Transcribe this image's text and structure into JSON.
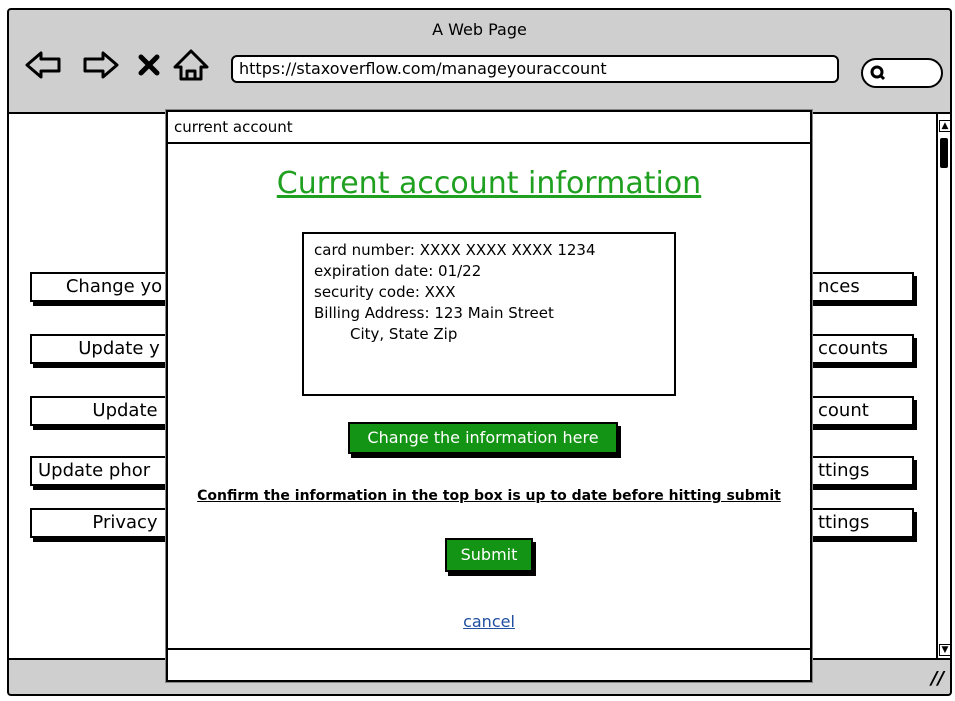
{
  "window": {
    "title": "A Web Page"
  },
  "toolbar": {
    "back_icon": "arrow-left-icon",
    "forward_icon": "arrow-right-icon",
    "stop_icon": "close-icon",
    "home_icon": "home-icon",
    "url": "https://staxoverflow.com/manageyouraccount",
    "search_icon": "search-icon"
  },
  "background_buttons": {
    "left": [
      "Change yo",
      "Update y",
      "Update",
      "Update phor",
      "Privacy"
    ],
    "right": [
      "nces",
      "ccounts",
      "count",
      "ttings",
      "ttings"
    ]
  },
  "dialog": {
    "title": "current account",
    "heading": "Current account information",
    "card_number": "card number: XXXX XXXX XXXX 1234",
    "expiration": "expiration date: 01/22",
    "security_code": "security code: XXX",
    "billing_line1": "Billing Address: 123 Main Street",
    "billing_line2": "City, State Zip",
    "change_button": "Change the information here",
    "confirm_text": "Confirm the information in the top box is up to date before hitting submit",
    "submit_button": "Submit",
    "cancel_link": "cancel"
  },
  "colors": {
    "accent_green": "#149414",
    "heading_green": "#20a020",
    "link_blue": "#1f4fa0"
  }
}
